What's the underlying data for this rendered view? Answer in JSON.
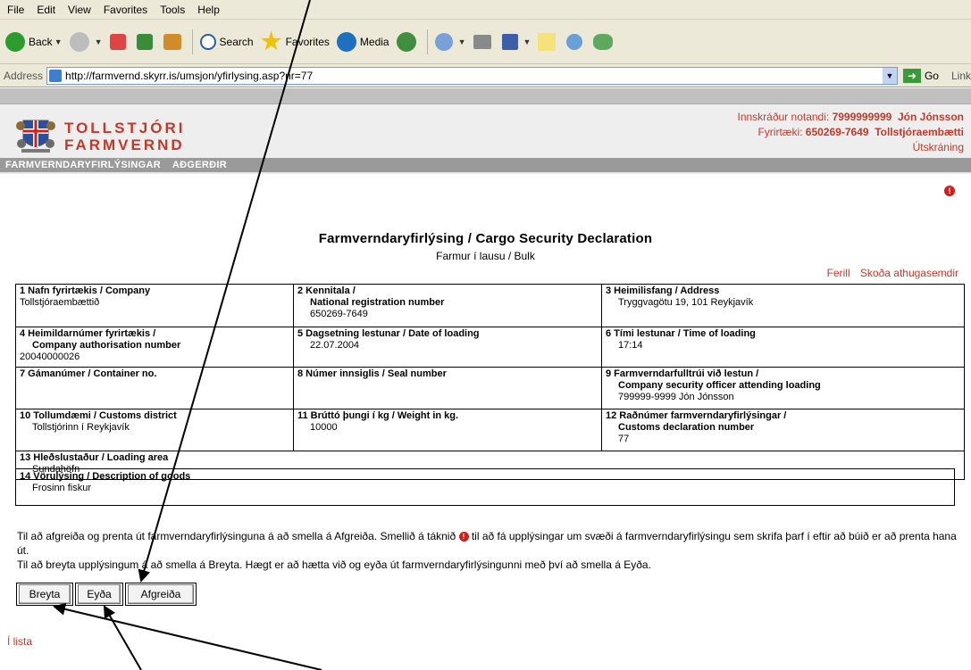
{
  "browser": {
    "menu": [
      "File",
      "Edit",
      "View",
      "Favorites",
      "Tools",
      "Help"
    ],
    "toolbar": {
      "back_label": "Back",
      "search_label": "Search",
      "favorites_label": "Favorites",
      "media_label": "Media"
    },
    "address": {
      "label": "Address",
      "url": "http://farmvernd.skyrr.is/umsjon/yfirlysing.asp?nr=77",
      "go_label": "Go",
      "links_label": "Link"
    }
  },
  "header": {
    "brand_line1": "TOLLSTJÓRI",
    "brand_line2": "FARMVERND",
    "user_label": "Innskráður notandi:",
    "user_id": "7999999999",
    "user_name": "Jón Jónsson",
    "company_label": "Fyrirtæki:",
    "company_id": "650269-7649",
    "company_name": "Tollstjóraembætti",
    "logout": "Útskráning"
  },
  "nav": {
    "items": [
      "FARMVERNDARYFIRLÝSINGAR",
      "AÐGERÐIR"
    ]
  },
  "main": {
    "title": "Farmverndaryfirlýsing / Cargo Security Declaration",
    "subtitle": "Farmur í lausu / Bulk",
    "links": [
      "Ferill",
      "Skoða athugasemdir"
    ],
    "fields": {
      "f1_label": "1 Nafn fyrirtækis / Company",
      "f1_value": "Tollstjóraembættið",
      "f2_label1": "2 Kennitala /",
      "f2_label2": "National registration number",
      "f2_value": "650269-7649",
      "f3_label": "3 Heimilisfang / Address",
      "f3_value": "Tryggvagötu 19, 101 Reykjavík",
      "f4_label1": "4 Heimildarnúmer fyrirtækis /",
      "f4_label2": "Company authorisation number",
      "f4_value": "20040000026",
      "f5_label": "5 Dagsetning lestunar / Date of loading",
      "f5_value": "22.07.2004",
      "f6_label": "6 Tími lestunar / Time of loading",
      "f6_value": "17:14",
      "f7_label": "7 Gámanúmer / Container no.",
      "f8_label": "8 Númer innsiglis / Seal number",
      "f9_label1": "9 Farmverndarfulltrúi við lestun /",
      "f9_label2": "Company security officer attending loading",
      "f9_value": "799999-9999 Jón Jónsson",
      "f10_label": "10 Tollumdæmi / Customs district",
      "f10_value": "Tollstjórinn í Reykjavík",
      "f11_label": "11 Brúttó þungi í kg / Weight in kg.",
      "f11_value": "10000",
      "f12_label1": "12 Raðnúmer farmverndaryfirlýsingar /",
      "f12_label2": "Customs declaration number",
      "f12_value": "77",
      "f13_label": "13 Hleðslustaður / Loading area",
      "f13_value": "Sundahöfn",
      "f14_label": "14 Vörulýsing / Description of goods",
      "f14_value": "Frosinn fiskur"
    },
    "instructions": {
      "line1a": "Til að afgreiða og prenta út farmverndaryfirlýsinguna á að smella á Afgreiða.  Smellið á táknið",
      "line1b": "til að fá upplýsingar um svæði á farmverndaryfirlýsingu sem skrifa þarf í eftir að búið er að prenta hana út.",
      "line2": "Til að breyta upplýsingum á að smella á Breyta. Hægt er að hætta við og eyða út farmverndaryfirlýsingunni með því að smella á Eyða."
    },
    "buttons": {
      "edit": "Breyta",
      "delete": "Eyða",
      "process": "Afgreiða"
    },
    "back_link": "Í lista"
  },
  "colors": {
    "brand_red": "#c0392b",
    "nav_gray": "#9a9a9a",
    "header_bg": "#eeeeee"
  }
}
